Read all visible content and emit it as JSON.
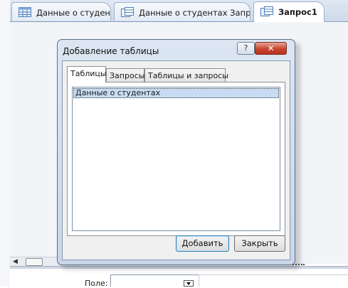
{
  "document_tabs": [
    {
      "label": "Данные о студентах",
      "active": false
    },
    {
      "label": "Данные о студентах Запрос",
      "active": false
    },
    {
      "label": "Запрос1",
      "active": true
    }
  ],
  "dialog": {
    "title": "Добавление таблицы",
    "help_label": "?",
    "close_label": "✕",
    "tabs": [
      {
        "label": "Таблицы",
        "selected": true
      },
      {
        "label": "Запросы",
        "selected": false
      },
      {
        "label": "Таблицы и запросы",
        "selected": false
      }
    ],
    "list_items": [
      "Данные о студентах"
    ],
    "add_button": "Добавить",
    "close_button": "Закрыть"
  },
  "grid": {
    "field_label": "Поле:"
  },
  "scroll": {
    "left_arrow": "◀"
  },
  "colors": {
    "selection": "#c7dcf3",
    "close_button_red": "#c9442f",
    "tabbar": "#cdd9e9"
  }
}
